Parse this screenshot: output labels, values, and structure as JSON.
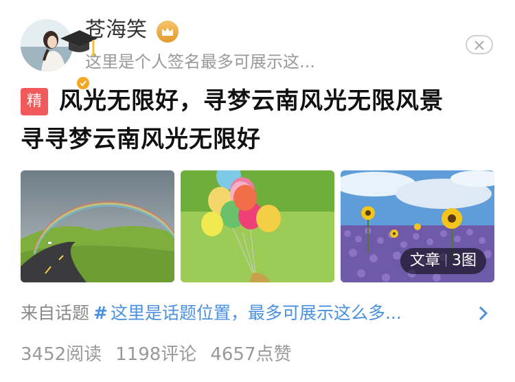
{
  "author": {
    "name": "苍海笑",
    "signature": "这里是个人签名最多可展示这...",
    "avatar_icon": "avatar-photo",
    "verified_icon": "verified-check-icon",
    "vip_icon": "crown-icon"
  },
  "close_icon": "close-icon",
  "post": {
    "badge": "精",
    "title_line_1": "风光无限好，寻梦云南风光无限风景",
    "title_line_2": "寻寻梦云南风光无限好",
    "images": [
      {
        "name": "rainbow-road-photo"
      },
      {
        "name": "balloons-photo"
      },
      {
        "name": "sunflowers-photo"
      }
    ],
    "image_tag": {
      "type": "文章",
      "count": "3图"
    }
  },
  "topic": {
    "prefix": "来自话题",
    "hash": "#",
    "text": "这里是话题位置，最多可展示这么多...",
    "arrow_icon": "chevron-right-icon"
  },
  "stats": {
    "reads": "3452阅读",
    "comments": "1198评论",
    "likes": "4657点赞"
  },
  "colors": {
    "link": "#4a90e2",
    "badge": "#f05a5a",
    "verified": "#f5a623",
    "muted": "#999999"
  }
}
